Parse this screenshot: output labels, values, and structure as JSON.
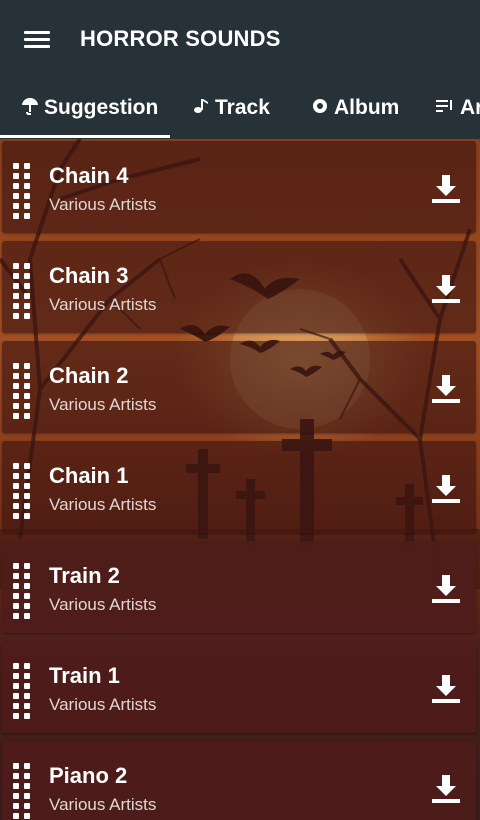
{
  "app": {
    "title": "HORROR SOUNDS"
  },
  "icons": {
    "menu": "menu-icon",
    "download": "download-icon",
    "drag": "drag-handle-icon"
  },
  "colors": {
    "appbar": "#263238",
    "row": "#4e1c1a",
    "accent": "#ffffff"
  },
  "tabs": [
    {
      "label": "Suggestion",
      "icon": "umbrella-icon",
      "selected": true
    },
    {
      "label": "Track",
      "icon": "music-note-icon",
      "selected": false
    },
    {
      "label": "Album",
      "icon": "disc-icon",
      "selected": false
    },
    {
      "label": "Ar",
      "icon": "playlist-icon",
      "selected": false
    }
  ],
  "tracks": [
    {
      "title": "Chain 4",
      "artist": "Various Artists"
    },
    {
      "title": "Chain 3",
      "artist": "Various Artists"
    },
    {
      "title": "Chain 2",
      "artist": "Various Artists"
    },
    {
      "title": "Chain 1",
      "artist": "Various Artists"
    },
    {
      "title": "Train 2",
      "artist": "Various Artists"
    },
    {
      "title": "Train 1",
      "artist": "Various Artists"
    },
    {
      "title": "Piano 2",
      "artist": "Various Artists"
    }
  ]
}
